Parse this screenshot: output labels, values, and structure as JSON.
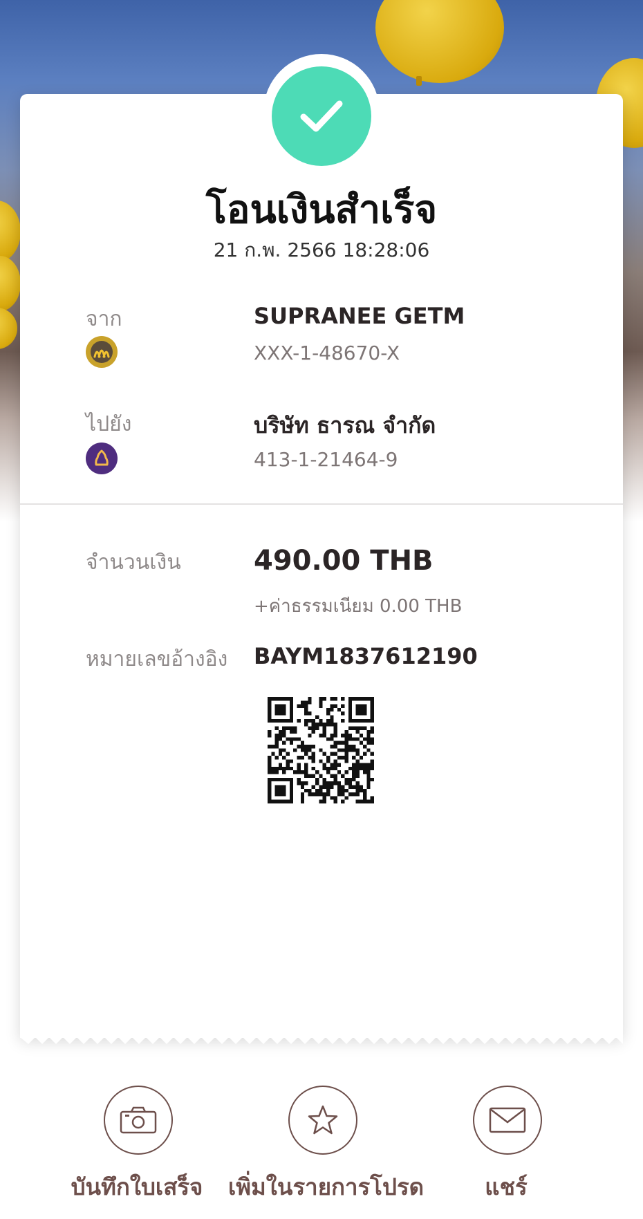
{
  "receipt": {
    "title": "โอนเงินสำเร็จ",
    "datetime": "21 ก.พ. 2566 18:28:06"
  },
  "from": {
    "label": "จาก",
    "name": "SUPRANEE GETM",
    "account": "XXX-1-48670-X",
    "bank_icon": "krungsri-bank-icon"
  },
  "to": {
    "label": "ไปยัง",
    "name": "บริษัท ธารณ จำกัด",
    "account": "413-1-21464-9",
    "bank_icon": "scb-bank-icon"
  },
  "amount": {
    "label": "จำนวนเงิน",
    "value": "490.00 THB",
    "fee": "+ค่าธรรมเนียม 0.00 THB"
  },
  "reference": {
    "label": "หมายเลขอ้างอิง",
    "value": "BAYM1837612190"
  },
  "actions": [
    {
      "label": "บันทึกใบเสร็จ",
      "icon": "camera-icon"
    },
    {
      "label": "เพิ่มในรายการโปรด",
      "icon": "star-icon"
    },
    {
      "label": "แชร์",
      "icon": "envelope-icon"
    }
  ],
  "colors": {
    "success": "#4ddbb6",
    "action": "#6d4f4b",
    "krungsri": "#f2c230",
    "scb": "#4f2d7f"
  }
}
